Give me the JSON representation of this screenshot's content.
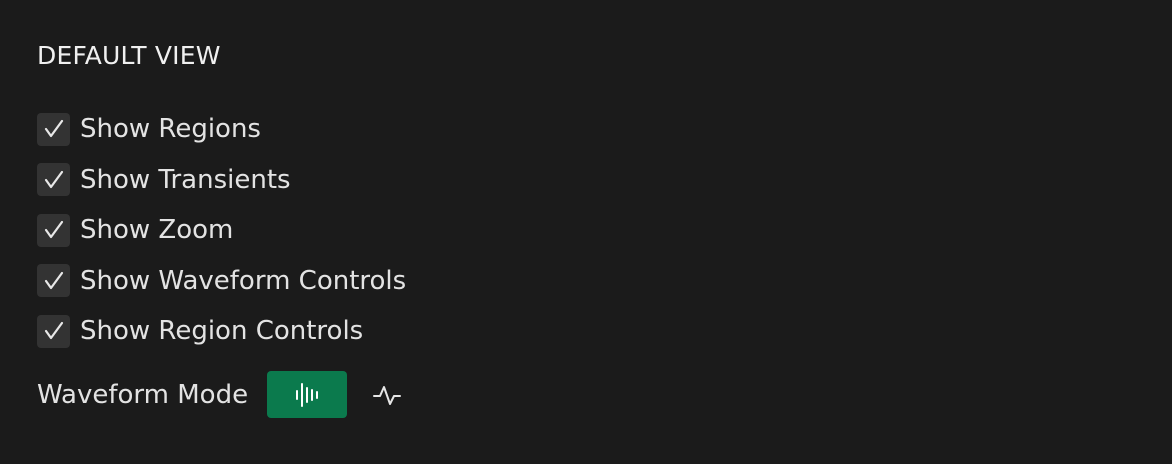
{
  "section": {
    "title": "DEFAULT VIEW"
  },
  "options": [
    {
      "label": "Show Regions",
      "checked": true
    },
    {
      "label": "Show Transients",
      "checked": true
    },
    {
      "label": "Show Zoom",
      "checked": true
    },
    {
      "label": "Show Waveform Controls",
      "checked": true
    },
    {
      "label": "Show Region Controls",
      "checked": true
    }
  ],
  "waveform_mode": {
    "label": "Waveform Mode",
    "modes": [
      {
        "icon": "waveform-bars-icon",
        "selected": true
      },
      {
        "icon": "waveform-line-icon",
        "selected": false
      }
    ]
  },
  "colors": {
    "background": "#1b1b1b",
    "checkbox_bg": "#333333",
    "accent": "#0b7a4d",
    "text": "#e3e3e3"
  }
}
